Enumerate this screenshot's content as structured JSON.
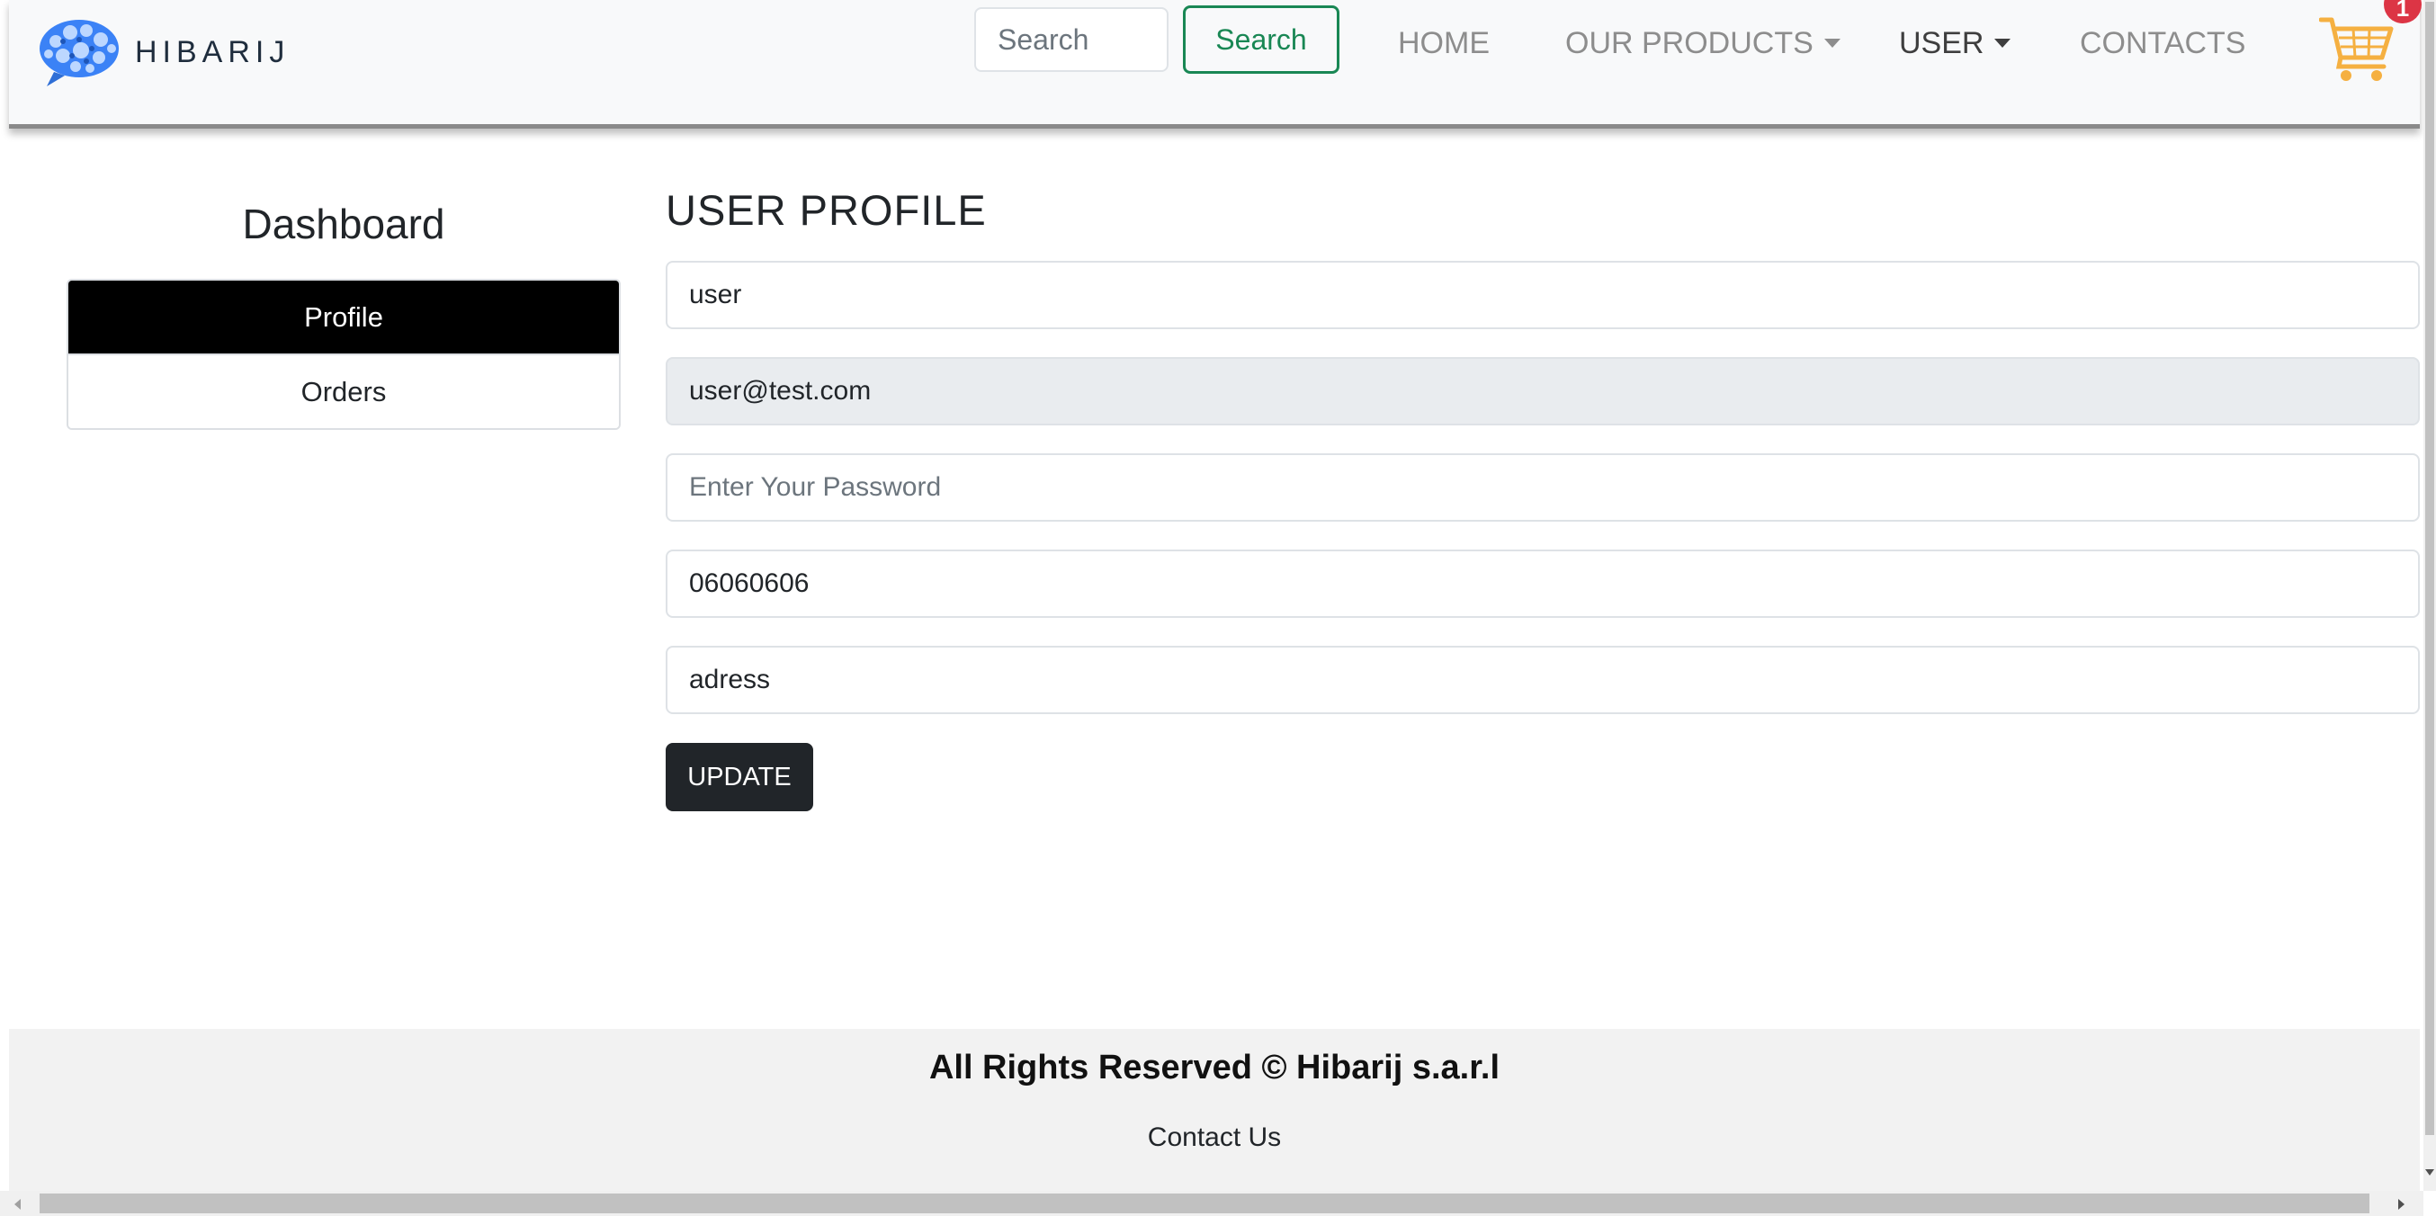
{
  "header": {
    "brand": "HIBARIJ",
    "logo_icon": "brain-chat-bubble-logo",
    "search": {
      "placeholder": "Search",
      "button_label": "Search"
    },
    "nav": {
      "home": "HOME",
      "products": "OUR PRODUCTS",
      "user": "USER",
      "contacts": "CONTACTS"
    },
    "cart_icon": "shopping-cart-icon",
    "cart_badge": "1"
  },
  "sidebar": {
    "title": "Dashboard",
    "items": [
      {
        "label": "Profile",
        "active": true
      },
      {
        "label": "Orders",
        "active": false
      }
    ]
  },
  "profile": {
    "title": "USER PROFILE",
    "name_value": "user",
    "email_value": "user@test.com",
    "password_placeholder": "Enter Your Password",
    "phone_value": "06060606",
    "address_value": "adress",
    "update_label": "UPDATE"
  },
  "footer": {
    "copyright": "All Rights Reserved © Hibarij s.a.r.l",
    "contact": "Contact Us"
  },
  "colors": {
    "navbar_bg": "#f8f9fa",
    "search_button": "#198754",
    "sidebar_active": "#000000",
    "update_button": "#212529",
    "cart": "#f5b041",
    "badge": "#dc3545",
    "footer_bg": "#f2f2f2"
  }
}
